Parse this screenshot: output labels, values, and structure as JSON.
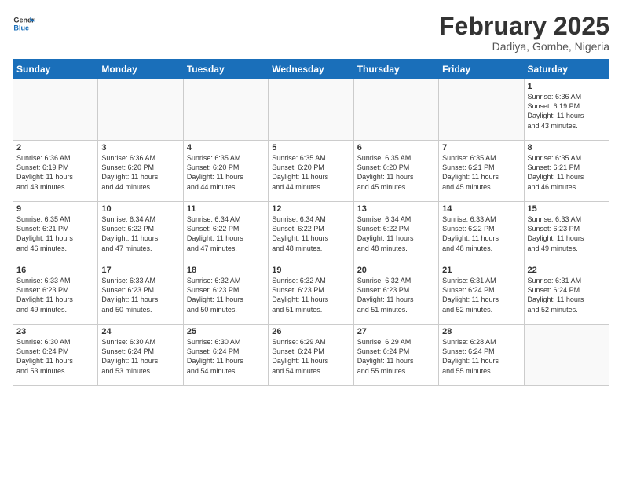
{
  "header": {
    "logo_general": "General",
    "logo_blue": "Blue",
    "month_title": "February 2025",
    "location": "Dadiya, Gombe, Nigeria"
  },
  "weekdays": [
    "Sunday",
    "Monday",
    "Tuesday",
    "Wednesday",
    "Thursday",
    "Friday",
    "Saturday"
  ],
  "weeks": [
    [
      {
        "day": "",
        "info": ""
      },
      {
        "day": "",
        "info": ""
      },
      {
        "day": "",
        "info": ""
      },
      {
        "day": "",
        "info": ""
      },
      {
        "day": "",
        "info": ""
      },
      {
        "day": "",
        "info": ""
      },
      {
        "day": "1",
        "info": "Sunrise: 6:36 AM\nSunset: 6:19 PM\nDaylight: 11 hours\nand 43 minutes."
      }
    ],
    [
      {
        "day": "2",
        "info": "Sunrise: 6:36 AM\nSunset: 6:19 PM\nDaylight: 11 hours\nand 43 minutes."
      },
      {
        "day": "3",
        "info": "Sunrise: 6:36 AM\nSunset: 6:20 PM\nDaylight: 11 hours\nand 44 minutes."
      },
      {
        "day": "4",
        "info": "Sunrise: 6:35 AM\nSunset: 6:20 PM\nDaylight: 11 hours\nand 44 minutes."
      },
      {
        "day": "5",
        "info": "Sunrise: 6:35 AM\nSunset: 6:20 PM\nDaylight: 11 hours\nand 44 minutes."
      },
      {
        "day": "6",
        "info": "Sunrise: 6:35 AM\nSunset: 6:20 PM\nDaylight: 11 hours\nand 45 minutes."
      },
      {
        "day": "7",
        "info": "Sunrise: 6:35 AM\nSunset: 6:21 PM\nDaylight: 11 hours\nand 45 minutes."
      },
      {
        "day": "8",
        "info": "Sunrise: 6:35 AM\nSunset: 6:21 PM\nDaylight: 11 hours\nand 46 minutes."
      }
    ],
    [
      {
        "day": "9",
        "info": "Sunrise: 6:35 AM\nSunset: 6:21 PM\nDaylight: 11 hours\nand 46 minutes."
      },
      {
        "day": "10",
        "info": "Sunrise: 6:34 AM\nSunset: 6:22 PM\nDaylight: 11 hours\nand 47 minutes."
      },
      {
        "day": "11",
        "info": "Sunrise: 6:34 AM\nSunset: 6:22 PM\nDaylight: 11 hours\nand 47 minutes."
      },
      {
        "day": "12",
        "info": "Sunrise: 6:34 AM\nSunset: 6:22 PM\nDaylight: 11 hours\nand 48 minutes."
      },
      {
        "day": "13",
        "info": "Sunrise: 6:34 AM\nSunset: 6:22 PM\nDaylight: 11 hours\nand 48 minutes."
      },
      {
        "day": "14",
        "info": "Sunrise: 6:33 AM\nSunset: 6:22 PM\nDaylight: 11 hours\nand 48 minutes."
      },
      {
        "day": "15",
        "info": "Sunrise: 6:33 AM\nSunset: 6:23 PM\nDaylight: 11 hours\nand 49 minutes."
      }
    ],
    [
      {
        "day": "16",
        "info": "Sunrise: 6:33 AM\nSunset: 6:23 PM\nDaylight: 11 hours\nand 49 minutes."
      },
      {
        "day": "17",
        "info": "Sunrise: 6:33 AM\nSunset: 6:23 PM\nDaylight: 11 hours\nand 50 minutes."
      },
      {
        "day": "18",
        "info": "Sunrise: 6:32 AM\nSunset: 6:23 PM\nDaylight: 11 hours\nand 50 minutes."
      },
      {
        "day": "19",
        "info": "Sunrise: 6:32 AM\nSunset: 6:23 PM\nDaylight: 11 hours\nand 51 minutes."
      },
      {
        "day": "20",
        "info": "Sunrise: 6:32 AM\nSunset: 6:23 PM\nDaylight: 11 hours\nand 51 minutes."
      },
      {
        "day": "21",
        "info": "Sunrise: 6:31 AM\nSunset: 6:24 PM\nDaylight: 11 hours\nand 52 minutes."
      },
      {
        "day": "22",
        "info": "Sunrise: 6:31 AM\nSunset: 6:24 PM\nDaylight: 11 hours\nand 52 minutes."
      }
    ],
    [
      {
        "day": "23",
        "info": "Sunrise: 6:30 AM\nSunset: 6:24 PM\nDaylight: 11 hours\nand 53 minutes."
      },
      {
        "day": "24",
        "info": "Sunrise: 6:30 AM\nSunset: 6:24 PM\nDaylight: 11 hours\nand 53 minutes."
      },
      {
        "day": "25",
        "info": "Sunrise: 6:30 AM\nSunset: 6:24 PM\nDaylight: 11 hours\nand 54 minutes."
      },
      {
        "day": "26",
        "info": "Sunrise: 6:29 AM\nSunset: 6:24 PM\nDaylight: 11 hours\nand 54 minutes."
      },
      {
        "day": "27",
        "info": "Sunrise: 6:29 AM\nSunset: 6:24 PM\nDaylight: 11 hours\nand 55 minutes."
      },
      {
        "day": "28",
        "info": "Sunrise: 6:28 AM\nSunset: 6:24 PM\nDaylight: 11 hours\nand 55 minutes."
      },
      {
        "day": "",
        "info": ""
      }
    ]
  ]
}
